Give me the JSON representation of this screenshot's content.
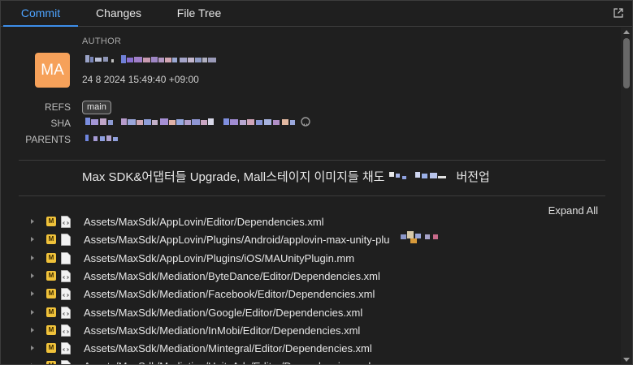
{
  "tabs": [
    {
      "label": "Commit"
    },
    {
      "label": "Changes"
    },
    {
      "label": "File Tree"
    }
  ],
  "author": {
    "label": "AUTHOR",
    "initials": "MA",
    "avatar_color": "#f6a15a",
    "date": "24 8 2024 15:49:40 +09:00"
  },
  "meta": {
    "refs_label": "REFS",
    "sha_label": "SHA",
    "parents_label": "PARENTS",
    "ref_badge": "main"
  },
  "message": {
    "text_before": "Max SDK&어댑터들 Upgrade, Mall스테이지 이미지들 채도",
    "text_after": "버전업"
  },
  "files": {
    "expand_all": "Expand All",
    "rows": [
      {
        "path": "Assets/MaxSdk/AppLovin/Editor/Dependencies.xml",
        "icon": "xml-file-icon"
      },
      {
        "path": "Assets/MaxSdk/AppLovin/Plugins/Android/applovin-max-unity-plu",
        "icon": "generic-file-icon"
      },
      {
        "path": "Assets/MaxSdk/AppLovin/Plugins/iOS/MAUnityPlugin.mm",
        "icon": "generic-file-icon"
      },
      {
        "path": "Assets/MaxSdk/Mediation/ByteDance/Editor/Dependencies.xml",
        "icon": "xml-file-icon"
      },
      {
        "path": "Assets/MaxSdk/Mediation/Facebook/Editor/Dependencies.xml",
        "icon": "xml-file-icon"
      },
      {
        "path": "Assets/MaxSdk/Mediation/Google/Editor/Dependencies.xml",
        "icon": "xml-file-icon"
      },
      {
        "path": "Assets/MaxSdk/Mediation/InMobi/Editor/Dependencies.xml",
        "icon": "xml-file-icon"
      },
      {
        "path": "Assets/MaxSdk/Mediation/Mintegral/Editor/Dependencies.xml",
        "icon": "xml-file-icon"
      },
      {
        "path": "Assets/MaxSdk/Mediation/UnityAds/Editor/Dependencies.xml",
        "icon": "xml-file-icon"
      }
    ],
    "modified_badge": "M",
    "badge_color": "#f0c23a"
  }
}
